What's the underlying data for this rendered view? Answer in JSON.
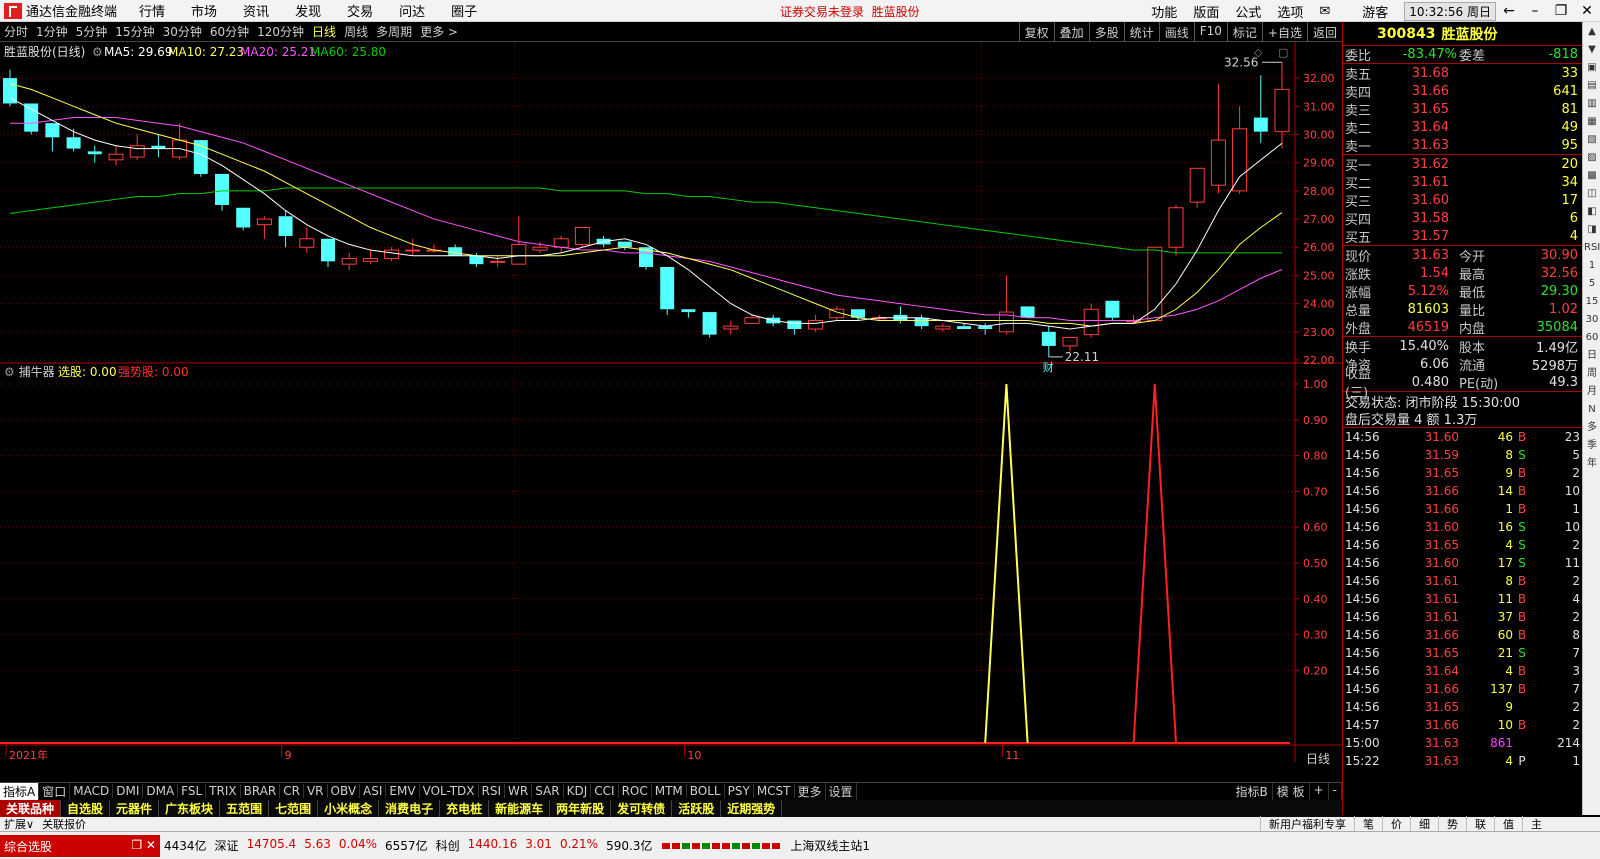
{
  "menubar": {
    "app_title": "通达信金融终端",
    "items": [
      "行情",
      "市场",
      "资讯",
      "发现",
      "交易",
      "问达",
      "圈子"
    ],
    "notice_a": "证券交易未登录",
    "notice_b": "胜蓝股份",
    "right_items": [
      "功能",
      "版面",
      "公式",
      "选项"
    ],
    "user": "游客",
    "clock": "10:32:56 周日"
  },
  "toolbar": {
    "periods": [
      "分时",
      "1分钟",
      "5分钟",
      "15分钟",
      "30分钟",
      "60分钟",
      "120分钟",
      "日线",
      "周线",
      "多周期",
      "更多 >"
    ],
    "active": "日线",
    "right_buttons": [
      "复权",
      "叠加",
      "多股",
      "统计",
      "画线",
      "F10",
      "标记",
      "+自选",
      "返回"
    ]
  },
  "chart_header": {
    "title": "胜蓝股份(日线)",
    "ma5": "MA5: 29.69",
    "ma10": "MA10: 27.23",
    "ma20": "MA20: 25.21",
    "ma60": "MA60: 25.80",
    "high_label": "32.56",
    "low_label": "22.11",
    "low_marker": "财",
    "x_labels": [
      "2021年",
      "9",
      "10",
      "11"
    ],
    "y_labels": [
      "32.00",
      "31.00",
      "30.00",
      "29.00",
      "28.00",
      "27.00",
      "26.00",
      "25.00",
      "24.00",
      "23.00",
      "22.00"
    ],
    "right_corner": "日线"
  },
  "indicator": {
    "name": "捕牛器",
    "label1": "选股: 0.00",
    "label2": "强势股: 0.00",
    "y_labels": [
      "1.00",
      "0.90",
      "0.80",
      "0.70",
      "0.60",
      "0.50",
      "0.40",
      "0.30",
      "0.20"
    ]
  },
  "chart_data": {
    "type": "candlestick",
    "x": [
      "2021-07-29",
      "2021-07-30",
      "2021-08-02",
      "2021-08-03",
      "2021-08-04",
      "2021-08-05",
      "2021-08-06",
      "2021-08-09",
      "2021-08-10",
      "2021-08-11",
      "2021-08-12",
      "2021-08-13",
      "2021-08-16",
      "2021-08-17",
      "2021-08-18",
      "2021-08-19",
      "2021-08-20",
      "2021-08-23",
      "2021-08-24",
      "2021-08-25",
      "2021-08-26",
      "2021-08-27",
      "2021-08-30",
      "2021-08-31",
      "2021-09-01",
      "2021-09-02",
      "2021-09-03",
      "2021-09-06",
      "2021-09-07",
      "2021-09-08",
      "2021-09-09",
      "2021-09-10",
      "2021-09-13",
      "2021-09-14",
      "2021-09-15",
      "2021-09-16",
      "2021-09-17",
      "2021-09-22",
      "2021-09-23",
      "2021-09-24",
      "2021-09-27",
      "2021-09-28",
      "2021-09-29",
      "2021-09-30",
      "2021-10-08",
      "2021-10-11",
      "2021-10-12",
      "2021-10-13",
      "2021-10-14",
      "2021-10-15",
      "2021-10-18",
      "2021-10-19",
      "2021-10-20",
      "2021-10-21",
      "2021-10-22",
      "2021-10-25",
      "2021-10-26",
      "2021-10-27",
      "2021-10-28",
      "2021-10-29",
      "2021-11-01"
    ],
    "ohlc": [
      [
        32.0,
        32.3,
        31.0,
        31.1
      ],
      [
        31.1,
        31.1,
        30.0,
        30.1
      ],
      [
        30.4,
        30.4,
        29.4,
        29.9
      ],
      [
        29.9,
        30.2,
        29.4,
        29.5
      ],
      [
        29.4,
        29.6,
        29.0,
        29.3
      ],
      [
        29.1,
        29.6,
        28.9,
        29.3
      ],
      [
        29.2,
        30.0,
        29.1,
        29.6
      ],
      [
        29.6,
        30.0,
        29.2,
        29.5
      ],
      [
        29.2,
        30.4,
        29.1,
        29.8
      ],
      [
        29.8,
        29.8,
        28.5,
        28.6
      ],
      [
        28.6,
        28.6,
        27.3,
        27.5
      ],
      [
        27.4,
        27.4,
        26.6,
        26.7
      ],
      [
        26.8,
        27.1,
        26.3,
        27.0
      ],
      [
        27.1,
        27.3,
        26.0,
        26.4
      ],
      [
        26.0,
        26.7,
        25.8,
        26.3
      ],
      [
        26.3,
        26.3,
        25.3,
        25.5
      ],
      [
        25.4,
        25.8,
        25.2,
        25.6
      ],
      [
        25.5,
        25.9,
        25.4,
        25.6
      ],
      [
        25.6,
        26.0,
        25.5,
        25.9
      ],
      [
        25.9,
        26.3,
        25.7,
        25.9
      ],
      [
        25.9,
        26.1,
        25.8,
        25.9
      ],
      [
        26.0,
        26.1,
        25.7,
        25.7
      ],
      [
        25.7,
        25.8,
        25.3,
        25.4
      ],
      [
        25.5,
        25.7,
        25.3,
        25.5
      ],
      [
        25.4,
        27.1,
        25.4,
        26.1
      ],
      [
        25.9,
        26.2,
        25.8,
        26.0
      ],
      [
        26.0,
        26.4,
        25.8,
        26.3
      ],
      [
        26.1,
        26.7,
        26.0,
        26.7
      ],
      [
        26.3,
        26.4,
        26.0,
        26.1
      ],
      [
        26.2,
        26.2,
        25.9,
        26.0
      ],
      [
        26.0,
        26.0,
        25.2,
        25.3
      ],
      [
        25.3,
        25.3,
        23.6,
        23.8
      ],
      [
        23.8,
        23.8,
        23.5,
        23.7
      ],
      [
        23.7,
        23.7,
        22.8,
        22.9
      ],
      [
        23.1,
        23.4,
        22.9,
        23.2
      ],
      [
        23.3,
        23.6,
        23.3,
        23.5
      ],
      [
        23.5,
        23.6,
        23.2,
        23.3
      ],
      [
        23.4,
        23.4,
        22.9,
        23.1
      ],
      [
        23.1,
        23.6,
        23.0,
        23.4
      ],
      [
        23.5,
        23.9,
        23.4,
        23.8
      ],
      [
        23.8,
        23.8,
        23.4,
        23.5
      ],
      [
        23.5,
        23.6,
        23.4,
        23.5
      ],
      [
        23.6,
        23.9,
        23.3,
        23.4
      ],
      [
        23.5,
        23.6,
        23.1,
        23.2
      ],
      [
        23.1,
        23.3,
        23.0,
        23.2
      ],
      [
        23.2,
        23.3,
        23.1,
        23.1
      ],
      [
        23.2,
        23.3,
        22.9,
        23.1
      ],
      [
        23.0,
        25.0,
        22.9,
        23.7
      ],
      [
        23.9,
        23.9,
        23.5,
        23.5
      ],
      [
        23.0,
        23.2,
        22.1,
        22.5
      ],
      [
        22.5,
        22.8,
        22.3,
        22.8
      ],
      [
        22.9,
        24.0,
        22.8,
        23.8
      ],
      [
        24.1,
        24.1,
        23.4,
        23.5
      ],
      [
        23.4,
        23.6,
        23.3,
        23.4
      ],
      [
        23.4,
        26.0,
        23.4,
        26.0
      ],
      [
        26.0,
        27.5,
        25.7,
        27.4
      ],
      [
        27.6,
        28.8,
        27.4,
        28.8
      ],
      [
        28.2,
        31.8,
        27.9,
        29.8
      ],
      [
        28.0,
        31.0,
        27.9,
        30.2
      ],
      [
        30.6,
        32.1,
        29.7,
        30.1
      ],
      [
        30.1,
        32.56,
        29.5,
        31.6
      ]
    ],
    "ylim": [
      22.0,
      32.5
    ],
    "ma5": [
      31.3,
      30.9,
      30.5,
      30.1,
      29.8,
      29.6,
      29.5,
      29.5,
      29.5,
      29.3,
      28.9,
      28.4,
      27.9,
      27.3,
      26.8,
      26.4,
      26.1,
      25.9,
      25.8,
      25.7,
      25.7,
      25.7,
      25.7,
      25.6,
      25.7,
      25.7,
      25.8,
      26.0,
      26.2,
      26.3,
      26.1,
      25.7,
      25.2,
      24.6,
      24.0,
      23.6,
      23.4,
      23.3,
      23.3,
      23.4,
      23.4,
      23.5,
      23.5,
      23.5,
      23.4,
      23.3,
      23.2,
      23.3,
      23.3,
      23.2,
      23.1,
      23.2,
      23.3,
      23.3,
      23.8,
      24.7,
      25.9,
      27.3,
      28.5,
      29.1,
      29.69
    ],
    "ma10": [
      31.8,
      31.6,
      31.3,
      31.0,
      30.7,
      30.4,
      30.2,
      30.0,
      29.8,
      29.6,
      29.3,
      29.0,
      28.7,
      28.3,
      27.9,
      27.5,
      27.1,
      26.7,
      26.4,
      26.1,
      25.9,
      25.8,
      25.7,
      25.7,
      25.7,
      25.7,
      25.7,
      25.8,
      25.9,
      26.0,
      25.9,
      25.8,
      25.6,
      25.4,
      25.2,
      24.9,
      24.6,
      24.3,
      24.0,
      23.7,
      23.5,
      23.4,
      23.4,
      23.4,
      23.4,
      23.4,
      23.4,
      23.4,
      23.4,
      23.3,
      23.3,
      23.2,
      23.3,
      23.3,
      23.4,
      23.8,
      24.4,
      25.2,
      26.1,
      26.7,
      27.23
    ],
    "ma20": [
      30.4,
      30.4,
      30.5,
      30.6,
      30.6,
      30.6,
      30.5,
      30.4,
      30.3,
      30.1,
      29.9,
      29.7,
      29.4,
      29.1,
      28.8,
      28.5,
      28.2,
      27.9,
      27.6,
      27.3,
      27.0,
      26.8,
      26.6,
      26.4,
      26.2,
      26.1,
      26.0,
      25.9,
      25.9,
      25.8,
      25.8,
      25.7,
      25.6,
      25.5,
      25.3,
      25.1,
      24.9,
      24.7,
      24.5,
      24.3,
      24.2,
      24.1,
      24.0,
      23.9,
      23.8,
      23.7,
      23.6,
      23.6,
      23.5,
      23.5,
      23.4,
      23.4,
      23.4,
      23.4,
      23.5,
      23.6,
      23.8,
      24.1,
      24.5,
      24.9,
      25.21
    ],
    "ma60": [
      27.2,
      27.3,
      27.4,
      27.5,
      27.6,
      27.7,
      27.8,
      27.8,
      27.9,
      27.9,
      28.0,
      28.0,
      28.0,
      28.1,
      28.1,
      28.1,
      28.1,
      28.1,
      28.1,
      28.1,
      28.1,
      28.1,
      28.1,
      28.1,
      28.1,
      28.1,
      28.0,
      28.0,
      28.0,
      28.0,
      27.9,
      27.9,
      27.8,
      27.8,
      27.7,
      27.6,
      27.6,
      27.5,
      27.4,
      27.3,
      27.2,
      27.1,
      27.0,
      26.9,
      26.8,
      26.7,
      26.6,
      26.5,
      26.4,
      26.3,
      26.2,
      26.1,
      26.0,
      25.9,
      25.9,
      25.8,
      25.8,
      25.8,
      25.8,
      25.8,
      25.8
    ],
    "signal_xuangu": {
      "index": 47,
      "value": 1.0
    },
    "signal_qiangshi": {
      "index": 54,
      "value": 1.0
    },
    "indicator_ylim": [
      0,
      1.0
    ]
  },
  "quote": {
    "code": "300843",
    "name": "胜蓝股份",
    "weibi_label": "委比",
    "weibi": "-83.47%",
    "weicha_label": "委差",
    "weicha": "-818",
    "asks": [
      {
        "label": "卖五",
        "price": "31.68",
        "vol": "33"
      },
      {
        "label": "卖四",
        "price": "31.66",
        "vol": "641"
      },
      {
        "label": "卖三",
        "price": "31.65",
        "vol": "81"
      },
      {
        "label": "卖二",
        "price": "31.64",
        "vol": "49"
      },
      {
        "label": "卖一",
        "price": "31.63",
        "vol": "95"
      }
    ],
    "bids": [
      {
        "label": "买一",
        "price": "31.62",
        "vol": "20"
      },
      {
        "label": "买二",
        "price": "31.61",
        "vol": "34"
      },
      {
        "label": "买三",
        "price": "31.60",
        "vol": "17"
      },
      {
        "label": "买四",
        "price": "31.58",
        "vol": "6"
      },
      {
        "label": "买五",
        "price": "31.57",
        "vol": "4"
      }
    ],
    "stats": [
      {
        "l1": "现价",
        "v1": "31.63",
        "c1": "red",
        "l2": "今开",
        "v2": "30.90",
        "c2": "red"
      },
      {
        "l1": "涨跌",
        "v1": "1.54",
        "c1": "red",
        "l2": "最高",
        "v2": "32.56",
        "c2": "red"
      },
      {
        "l1": "涨幅",
        "v1": "5.12%",
        "c1": "red",
        "l2": "最低",
        "v2": "29.30",
        "c2": "green"
      },
      {
        "l1": "总量",
        "v1": "81603",
        "c1": "yel",
        "l2": "量比",
        "v2": "1.02",
        "c2": "red"
      },
      {
        "l1": "外盘",
        "v1": "46519",
        "c1": "red",
        "l2": "内盘",
        "v2": "35084",
        "c2": "green"
      }
    ],
    "stats2": [
      {
        "l1": "换手",
        "v1": "15.40%",
        "l2": "股本",
        "v2": "1.49亿"
      },
      {
        "l1": "净资",
        "v1": "6.06",
        "l2": "流通",
        "v2": "5298万"
      },
      {
        "l1": "收益(三)",
        "v1": "0.480",
        "l2": "PE(动)",
        "v2": "49.3"
      }
    ],
    "status_line": "交易状态: 闭市阶段 15:30:00",
    "after_line": "盘后交易量 4 额 1.3万",
    "ticks": [
      {
        "t": "14:56",
        "p": "31.60",
        "v": "46",
        "bs": "B",
        "c": "23"
      },
      {
        "t": "14:56",
        "p": "31.59",
        "v": "8",
        "bs": "S",
        "c": "5"
      },
      {
        "t": "14:56",
        "p": "31.65",
        "v": "9",
        "bs": "B",
        "c": "2"
      },
      {
        "t": "14:56",
        "p": "31.66",
        "v": "14",
        "bs": "B",
        "c": "10"
      },
      {
        "t": "14:56",
        "p": "31.66",
        "v": "1",
        "bs": "B",
        "c": "1"
      },
      {
        "t": "14:56",
        "p": "31.60",
        "v": "16",
        "bs": "S",
        "c": "10"
      },
      {
        "t": "14:56",
        "p": "31.65",
        "v": "4",
        "bs": "S",
        "c": "2"
      },
      {
        "t": "14:56",
        "p": "31.60",
        "v": "17",
        "bs": "S",
        "c": "11"
      },
      {
        "t": "14:56",
        "p": "31.61",
        "v": "8",
        "bs": "B",
        "c": "2"
      },
      {
        "t": "14:56",
        "p": "31.61",
        "v": "11",
        "bs": "B",
        "c": "4"
      },
      {
        "t": "14:56",
        "p": "31.61",
        "v": "37",
        "bs": "B",
        "c": "2"
      },
      {
        "t": "14:56",
        "p": "31.66",
        "v": "60",
        "bs": "B",
        "c": "8"
      },
      {
        "t": "14:56",
        "p": "31.65",
        "v": "21",
        "bs": "S",
        "c": "7"
      },
      {
        "t": "14:56",
        "p": "31.64",
        "v": "4",
        "bs": "B",
        "c": "3"
      },
      {
        "t": "14:56",
        "p": "31.66",
        "v": "137",
        "bs": "B",
        "c": "7"
      },
      {
        "t": "14:56",
        "p": "31.65",
        "v": "9",
        "bs": "",
        "c": "2"
      },
      {
        "t": "14:57",
        "p": "31.66",
        "v": "10",
        "bs": "B",
        "c": "2"
      },
      {
        "t": "15:00",
        "p": "31.63",
        "v": "861",
        "bs": "",
        "c": "214"
      },
      {
        "t": "15:22",
        "p": "31.63",
        "v": "4",
        "bs": "P",
        "c": "1"
      }
    ]
  },
  "indbar": {
    "items": [
      "指标A",
      "窗口",
      "MACD",
      "DMI",
      "DMA",
      "FSL",
      "TRIX",
      "BRAR",
      "CR",
      "VR",
      "OBV",
      "ASI",
      "EMV",
      "VOL-TDX",
      "RSI",
      "WR",
      "SAR",
      "KDJ",
      "CCI",
      "ROC",
      "MTM",
      "BOLL",
      "PSY",
      "MCST",
      "更多",
      "设置"
    ],
    "right": [
      "指标B",
      "模 板",
      "+",
      "-"
    ]
  },
  "sectorbar": {
    "items": [
      "关联品种",
      "自选股",
      "元器件",
      "广东板块",
      "五范围",
      "七范围",
      "小米概念",
      "消费电子",
      "充电桩",
      "新能源车",
      "两年新股",
      "发可转债",
      "活跃股",
      "近期强势"
    ]
  },
  "extrabar": {
    "left": [
      "扩展∨",
      "关联报价"
    ],
    "right": [
      "新用户福利专享",
      "笔",
      "价",
      "细",
      "势",
      "联",
      "值",
      "主"
    ]
  },
  "statusbar": {
    "combo": "综合选股",
    "items": [
      {
        "t": "4434亿",
        "c": ""
      },
      {
        "t": "深证",
        "c": ""
      },
      {
        "t": "14705.4",
        "c": "r"
      },
      {
        "t": "5.63",
        "c": "r"
      },
      {
        "t": "0.04%",
        "c": "r"
      },
      {
        "t": "6557亿",
        "c": ""
      },
      {
        "t": "科创",
        "c": ""
      },
      {
        "t": "1440.16",
        "c": "r"
      },
      {
        "t": "3.01",
        "c": "r"
      },
      {
        "t": "0.21%",
        "c": "r"
      },
      {
        "t": "590.3亿",
        "c": ""
      }
    ],
    "station": "上海双线主站1"
  },
  "sidestrip": [
    "RSI",
    "1",
    "5",
    "15",
    "30",
    "60",
    "日",
    "周",
    "月",
    "N",
    "多",
    "季",
    "年"
  ],
  "colors": {
    "up": "#ff3c3c",
    "down": "#54ffff",
    "ma5": "#ffffff",
    "ma10": "#ffff55",
    "ma20": "#ff55ff",
    "ma60": "#00cc00",
    "signal1": "#ffff55",
    "signal2": "#ff2020",
    "grid": "#7a0000"
  }
}
